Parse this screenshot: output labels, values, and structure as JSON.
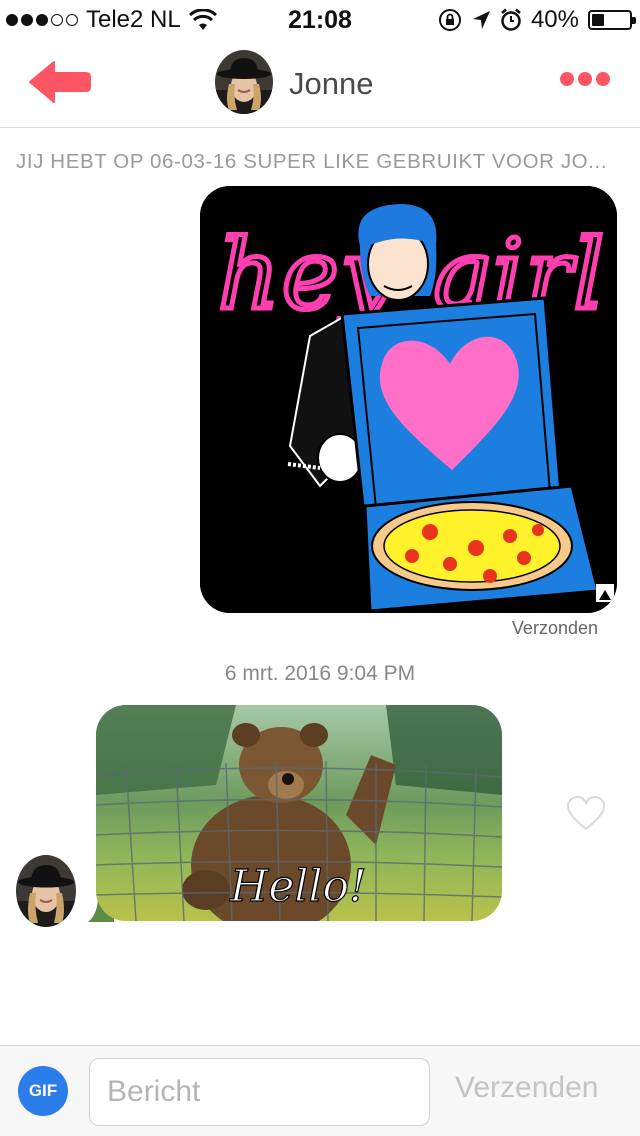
{
  "status_bar": {
    "carrier": "Tele2 NL",
    "time": "21:08",
    "battery": "40%",
    "battery_level": 0.4,
    "icons": [
      "wifi-icon",
      "rotation-lock-icon",
      "location-icon",
      "alarm-icon"
    ]
  },
  "header": {
    "name": "Jonne",
    "back_icon": "back-arrow-icon",
    "more_icon": "more-dots-icon"
  },
  "conversation": {
    "superlike_notice": "JIJ HEBT OP 06-03-16 SUPER LIKE GEBRUIKT VOOR JO...",
    "sent_gif": {
      "text": "hey girl",
      "status": "Verzonden"
    },
    "timestamp": "6 mrt. 2016 9:04 PM",
    "received_gif": {
      "caption": "Hello!"
    }
  },
  "input_bar": {
    "gif_label": "GIF",
    "placeholder": "Bericht",
    "value": "",
    "send_label": "Verzenden"
  },
  "colors": {
    "accent": "#fd5564",
    "gif_button": "#2b7de9",
    "neon_pink": "#ff3fb0",
    "pizza_box": "#1c7fe0",
    "heart": "#ff6fc8"
  }
}
